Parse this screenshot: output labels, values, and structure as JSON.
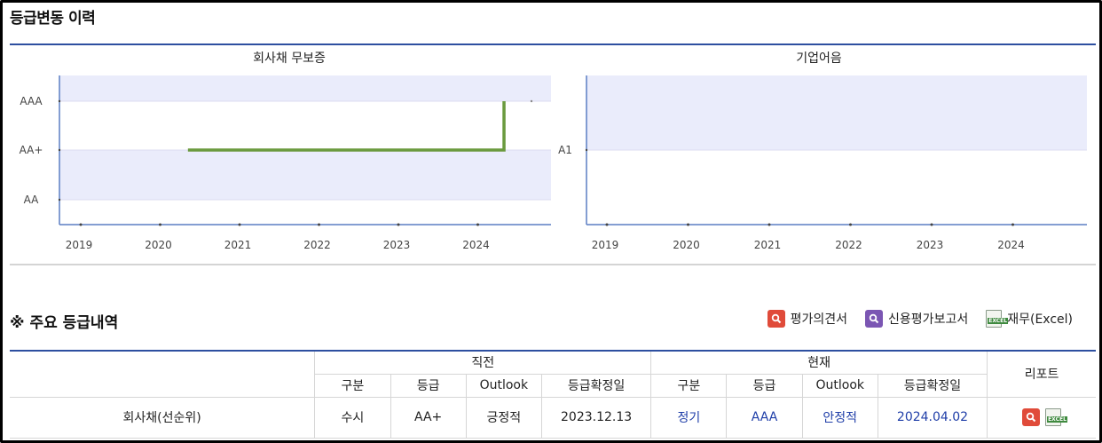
{
  "section_title": "등급변동 이력",
  "charts": [
    {
      "title": "회사채 무보증",
      "y_labels": [
        "AAA",
        "AA+",
        "AA"
      ],
      "x_labels": [
        "2019",
        "2020",
        "2021",
        "2022",
        "2023",
        "2024"
      ]
    },
    {
      "title": "기업어음",
      "y_labels": [
        "A1"
      ],
      "x_labels": [
        "2019",
        "2020",
        "2021",
        "2022",
        "2023",
        "2024"
      ]
    }
  ],
  "chart_data": [
    {
      "type": "line",
      "title": "회사채 무보증",
      "x_axis": "year",
      "y_categories": [
        "AAA",
        "AA+",
        "AA"
      ],
      "series": [
        {
          "points": [
            {
              "x": 2020.35,
              "y": "AA+"
            },
            {
              "x": 2024.33,
              "y": "AA+"
            },
            {
              "x": 2024.33,
              "y": "AAA"
            }
          ]
        }
      ],
      "line_color": "#6a9a3e",
      "band_color": "#eaecfb",
      "xlim": [
        2018.8,
        2025.0
      ]
    },
    {
      "type": "line",
      "title": "기업어음",
      "x_axis": "year",
      "y_categories": [
        "A1"
      ],
      "series": [],
      "band_color": "#eaecfb",
      "xlim": [
        2018.8,
        2025.0
      ]
    }
  ],
  "main_grades": {
    "title": "※ 주요 등급내역",
    "links": [
      {
        "label": "평가의견서",
        "icon": "search-icon",
        "color": "#e04b3a"
      },
      {
        "label": "신용평가보고서",
        "icon": "search-icon",
        "color": "#7b56b3"
      },
      {
        "label": "재무(Excel)",
        "icon": "excel-icon"
      }
    ],
    "group_prev": "직전",
    "group_curr": "현재",
    "report_header": "리포트",
    "sub_headers": [
      "구분",
      "등급",
      "Outlook",
      "등급확정일",
      "구분",
      "등급",
      "Outlook",
      "등급확정일"
    ],
    "rows": [
      {
        "name": "회사채(선순위)",
        "prev": [
          "수시",
          "AA+",
          "긍정적",
          "2023.12.13"
        ],
        "curr": [
          "정기",
          "AAA",
          "안정적",
          "2024.04.02"
        ]
      }
    ]
  }
}
